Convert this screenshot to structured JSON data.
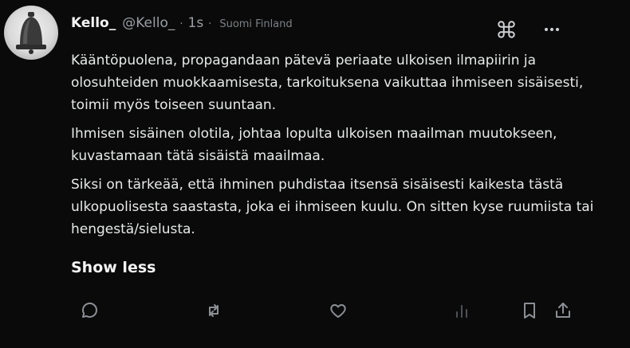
{
  "post": {
    "display_name": "Kello_",
    "handle": "@Kello_",
    "separator": "·",
    "time": "1s",
    "location_separator": "·",
    "location": "Suomi Finland",
    "paragraphs": [
      "Kääntöpuolena, propagandaan pätevä periaate ulkoisen ilmapiirin ja olosuhteiden muokkaamisesta, tarkoituksena vaikuttaa ihmiseen sisäisesti, toimii myös toiseen suuntaan.",
      "Ihmisen sisäinen olotila, johtaa lopulta ulkoisen maailman muutokseen, kuvastamaan tätä sisäistä maailmaa.",
      "Siksi on tärkeää, että ihminen puhdistaa itsensä sisäisesti kaikesta tästä ulkopuolisesta saastasta, joka ei ihmiseen kuulu. On sitten kyse ruumiista tai hengestä/sielusta."
    ],
    "show_less_label": "Show less"
  },
  "icons": {
    "avatar": "bell-avatar",
    "top_right": [
      "command-icon",
      "more-icon"
    ],
    "actions": [
      "reply-icon",
      "repost-icon",
      "like-icon",
      "views-icon",
      "bookmark-icon",
      "share-icon"
    ]
  }
}
